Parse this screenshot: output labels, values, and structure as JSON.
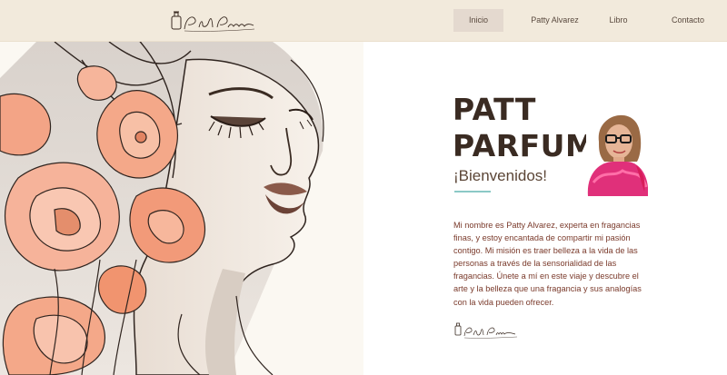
{
  "header": {
    "logo_text": "Patt Parfum",
    "nav": [
      {
        "label": "Inicio",
        "active": true
      },
      {
        "label": "Patty Alvarez",
        "active": false
      },
      {
        "label": "Libro",
        "active": false
      },
      {
        "label": "Contacto",
        "active": false
      }
    ]
  },
  "hero": {
    "title_line1": "PATT",
    "title_line2": "PARFUM",
    "subtitle": "¡Bienvenidos!",
    "paragraph": "Mi nombre es Patty Alvarez, experta en fragancias finas, y estoy encantada de compartir mi pasión contigo. Mi misión es traer belleza a la vida de las personas a través de la sensorialidad de las fragancias. Únete a mí en este viaje y descubre el arte y la belleza que una fragancia y sus analogías con la vida pueden ofrecer.",
    "signature_text": "Patt Parfum"
  },
  "colors": {
    "header_bg": "#f2eadc",
    "title": "#3a2b22",
    "paragraph": "#7a3a2b",
    "accent": "#8bc9c6",
    "flower": "#f2a07e"
  }
}
